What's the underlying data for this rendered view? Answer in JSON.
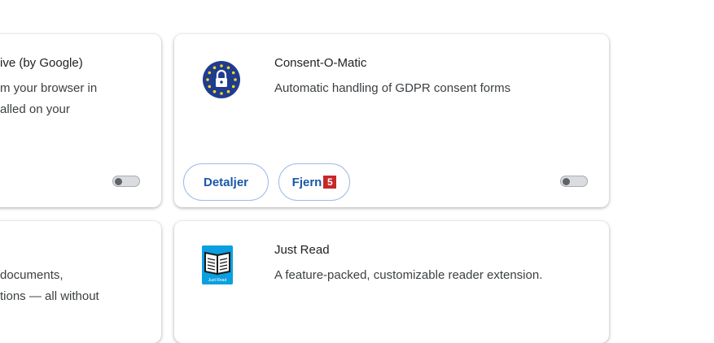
{
  "cards": {
    "left_top": {
      "name_fragment": "ive (by Google)",
      "desc_line1": "m your browser in",
      "desc_line2": "alled on your"
    },
    "left_bottom": {
      "desc_line1": "documents,",
      "desc_line2": "tions — all without"
    },
    "consent": {
      "name": "Consent-O-Matic",
      "description": "Automatic handling of GDPR consent forms",
      "details_label": "Detaljer",
      "remove_label": "Fjern",
      "remove_badge": "5",
      "icon": "eu-lock-icon",
      "enabled": false
    },
    "justread": {
      "name": "Just Read",
      "description": "A feature-packed, customizable reader extension.",
      "icon": "open-book-icon",
      "icon_caption": "Just Read"
    }
  },
  "colors": {
    "accent": "#1a57a8",
    "badge": "#c62828",
    "eu_blue": "#1f3c8f",
    "eu_star": "#f7d917",
    "justread_blue": "#0aa0e0"
  }
}
